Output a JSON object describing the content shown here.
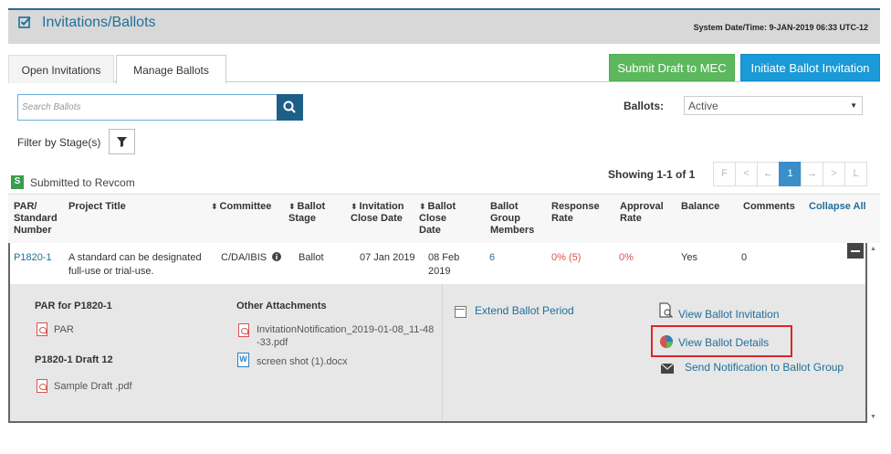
{
  "header": {
    "title": "Invitations/Ballots",
    "system_datetime": "System Date/Time: 9-JAN-2019   06:33 UTC-12"
  },
  "tabs": [
    {
      "label": "Open Invitations"
    },
    {
      "label": "Manage Ballots"
    }
  ],
  "buttons": {
    "submit_draft": "Submit Draft to MEC",
    "initiate_ballot": "Initiate Ballot Invitation"
  },
  "search": {
    "placeholder": "Search Ballots"
  },
  "filter": {
    "label": "Filter by Stage(s)"
  },
  "ballots_filter": {
    "label": "Ballots:",
    "selected": "Active"
  },
  "stage_badge": {
    "letter": "S",
    "label": "Submitted to Revcom",
    "color": "#3a9d4f"
  },
  "pagination": {
    "showing": "Showing 1-1 of 1",
    "pages": [
      "F",
      "<",
      "←",
      "1",
      "→",
      ">",
      "L"
    ],
    "current": "1"
  },
  "table": {
    "columns": [
      "PAR/\nStandard\nNumber",
      "Project Title",
      "Committee",
      "Ballot\nStage",
      "Invitation\nClose Date",
      "Ballot\nClose\nDate",
      "Ballot\nGroup\nMembers",
      "Response\nRate",
      "Approval\nRate",
      "Balance",
      "Comments"
    ],
    "collapse_all": "Collapse All",
    "row": {
      "par": "P1820-1",
      "title": "A standard can be designated full-use or trial-use.",
      "committee": "C/DA/IBIS",
      "stage": "Ballot",
      "invitation_close": "07 Jan 2019",
      "ballot_close": "08 Feb 2019",
      "members": "6",
      "response_rate": "0% (5)",
      "approval_rate": "0%",
      "balance": "Yes",
      "comments": "0"
    }
  },
  "detail": {
    "par_title": "PAR for P1820-1",
    "par_file": "PAR",
    "draft_title": "P1820-1 Draft 12",
    "draft_file": "Sample Draft .pdf",
    "other_title": "Other Attachments",
    "other_files": [
      "InvitationNotification_2019-01-08_11-48-33.pdf",
      "screen shot (1).docx"
    ],
    "extend": "Extend Ballot Period",
    "view_invitation": "View Ballot Invitation",
    "view_details": "View Ballot Details",
    "send_notification": "Send Notification to Ballot Group"
  },
  "colors": {
    "accent": "#1f6f9a",
    "green_button": "#5cb85c",
    "blue_button": "#1a9ad6",
    "highlight_box": "#d9262c",
    "rate_red": "#d9534f"
  }
}
